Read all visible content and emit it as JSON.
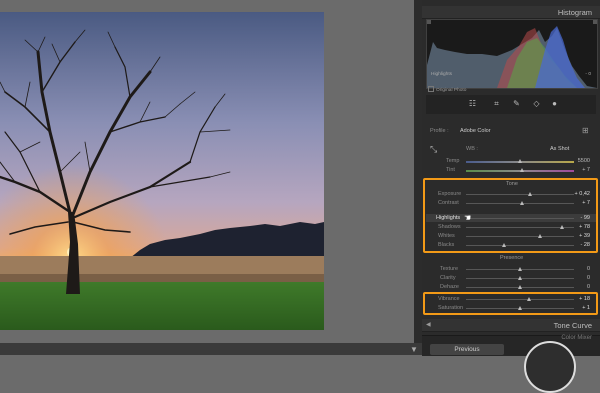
{
  "panel": {
    "histogram_title": "Histogram",
    "histogram_label": "Highlights",
    "histogram_dash": "- 0",
    "original_photo": "Original Photo",
    "profile_label": "Profile :",
    "profile_value": "Adobe Color",
    "wb_label": "WB :",
    "wb_value": "As Shot",
    "tone_curve_title": "Tone Curve",
    "color_mixer_title": "Color Mixer",
    "previous_button": "Previous",
    "tone_header": "Tone",
    "presence_header": "Presence"
  },
  "sliders": {
    "temp": {
      "label": "Temp",
      "value": "5500",
      "level": 0.5
    },
    "tint": {
      "label": "Tint",
      "value": "+ 7",
      "level": 0.52
    },
    "exposure": {
      "label": "Exposure",
      "value": "+ 0,42",
      "level": 0.6
    },
    "contrast": {
      "label": "Contrast",
      "value": "+ 7",
      "level": 0.52
    },
    "highlights": {
      "label": "Highlights",
      "value": "- 99",
      "level": 0.02
    },
    "shadows": {
      "label": "Shadows",
      "value": "+ 78",
      "level": 0.89
    },
    "whites": {
      "label": "Whites",
      "value": "+ 39",
      "level": 0.69
    },
    "blacks": {
      "label": "Blacks",
      "value": "- 28",
      "level": 0.36
    },
    "texture": {
      "label": "Texture",
      "value": "0",
      "level": 0.5
    },
    "clarity": {
      "label": "Clarity",
      "value": "0",
      "level": 0.5
    },
    "dehaze": {
      "label": "Dehaze",
      "value": "0",
      "level": 0.5
    },
    "vibrance": {
      "label": "Vibrance",
      "value": "+ 18",
      "level": 0.59
    },
    "saturation": {
      "label": "Saturation",
      "value": "+ 1",
      "level": 0.5
    }
  },
  "colors": {
    "accent": "#f39a17",
    "panel_bg": "#2b2b2b"
  }
}
